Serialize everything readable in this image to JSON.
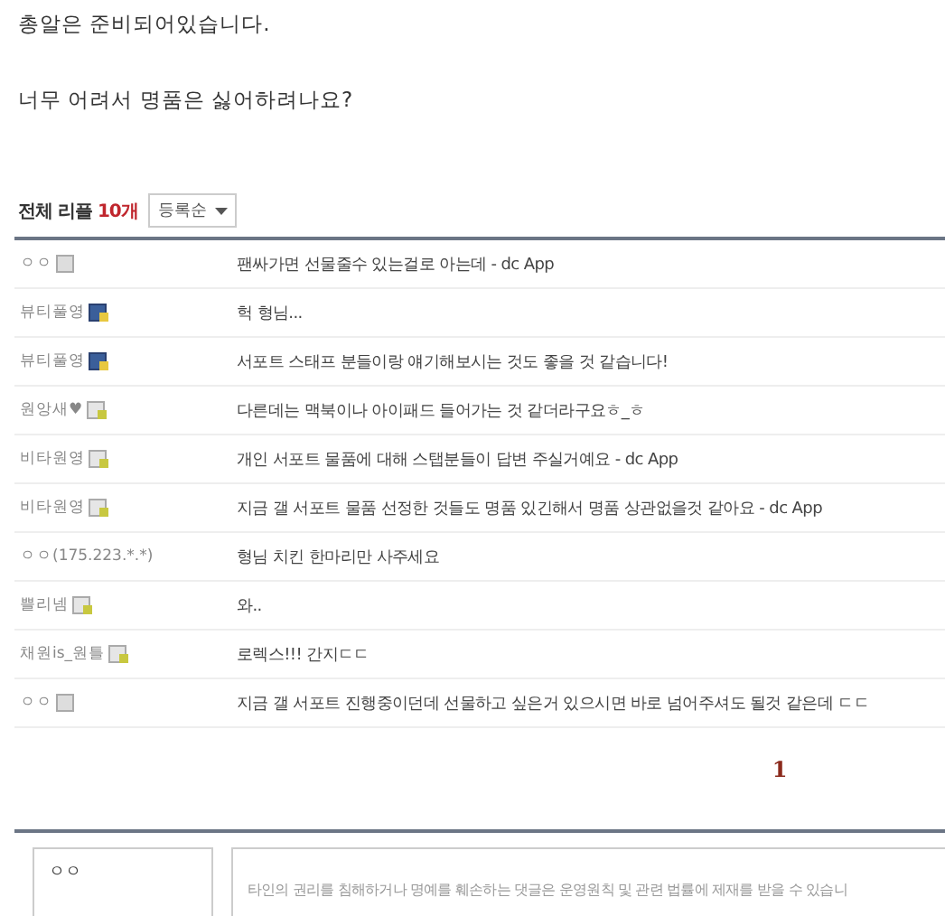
{
  "post_lines": [
    "총알은 준비되어있습니다.",
    "너무 어려서 명품은 싫어하려나요?"
  ],
  "comments_header": {
    "label": "전체 리플",
    "count": "10개",
    "sort": "등록순"
  },
  "comments": [
    {
      "name": "ㅇㅇ",
      "kind": "guest",
      "text": "팬싸가면 선물줄수 있는걸로 아는데 - dc App"
    },
    {
      "name": "뷰티풀영",
      "kind": "fixed",
      "text": "헉 형님..."
    },
    {
      "name": "뷰티풀영",
      "kind": "fixed",
      "text": "서포트 스태프 분들이랑 얘기해보시는 것도 좋을 것 같습니다!"
    },
    {
      "name": "원앙새♥",
      "kind": "half",
      "text": "다른데는 맥북이나 아이패드 들어가는 것 같더라구요ㅎ_ㅎ"
    },
    {
      "name": "비타원영",
      "kind": "half",
      "text": "개인 서포트 물품에 대해 스탭분들이 답변 주실거예요 - dc App"
    },
    {
      "name": "비타원영",
      "kind": "half",
      "text": "지금 갤 서포트 물품 선정한 것들도 명품 있긴해서 명품 상관없을것 같아요 - dc App"
    },
    {
      "name": "ㅇㅇ(175.223.*.*)",
      "kind": "ip",
      "text": "형님 치킨 한마리만 사주세요"
    },
    {
      "name": "쁠리넴",
      "kind": "half",
      "text": "와.."
    },
    {
      "name": "채원is_원틀",
      "kind": "half",
      "text": "로렉스!!! 간지ㄷㄷ"
    },
    {
      "name": "ㅇㅇ",
      "kind": "guest",
      "text": "지금 갤 서포트 진행중이던데 선물하고 싶은거 있으시면 바로 넘어주셔도 될것 같은데 ㄷㄷ"
    }
  ],
  "pagination": [
    {
      "label": "1",
      "selected": true
    }
  ],
  "write_form": {
    "name_value": "ㅇㅇ",
    "placeholder": "타인의 권리를 침해하거나 명예를 훼손하는 댓글은 운영원칙 및 관련 법률에 제재를 받을 수 있습니"
  }
}
